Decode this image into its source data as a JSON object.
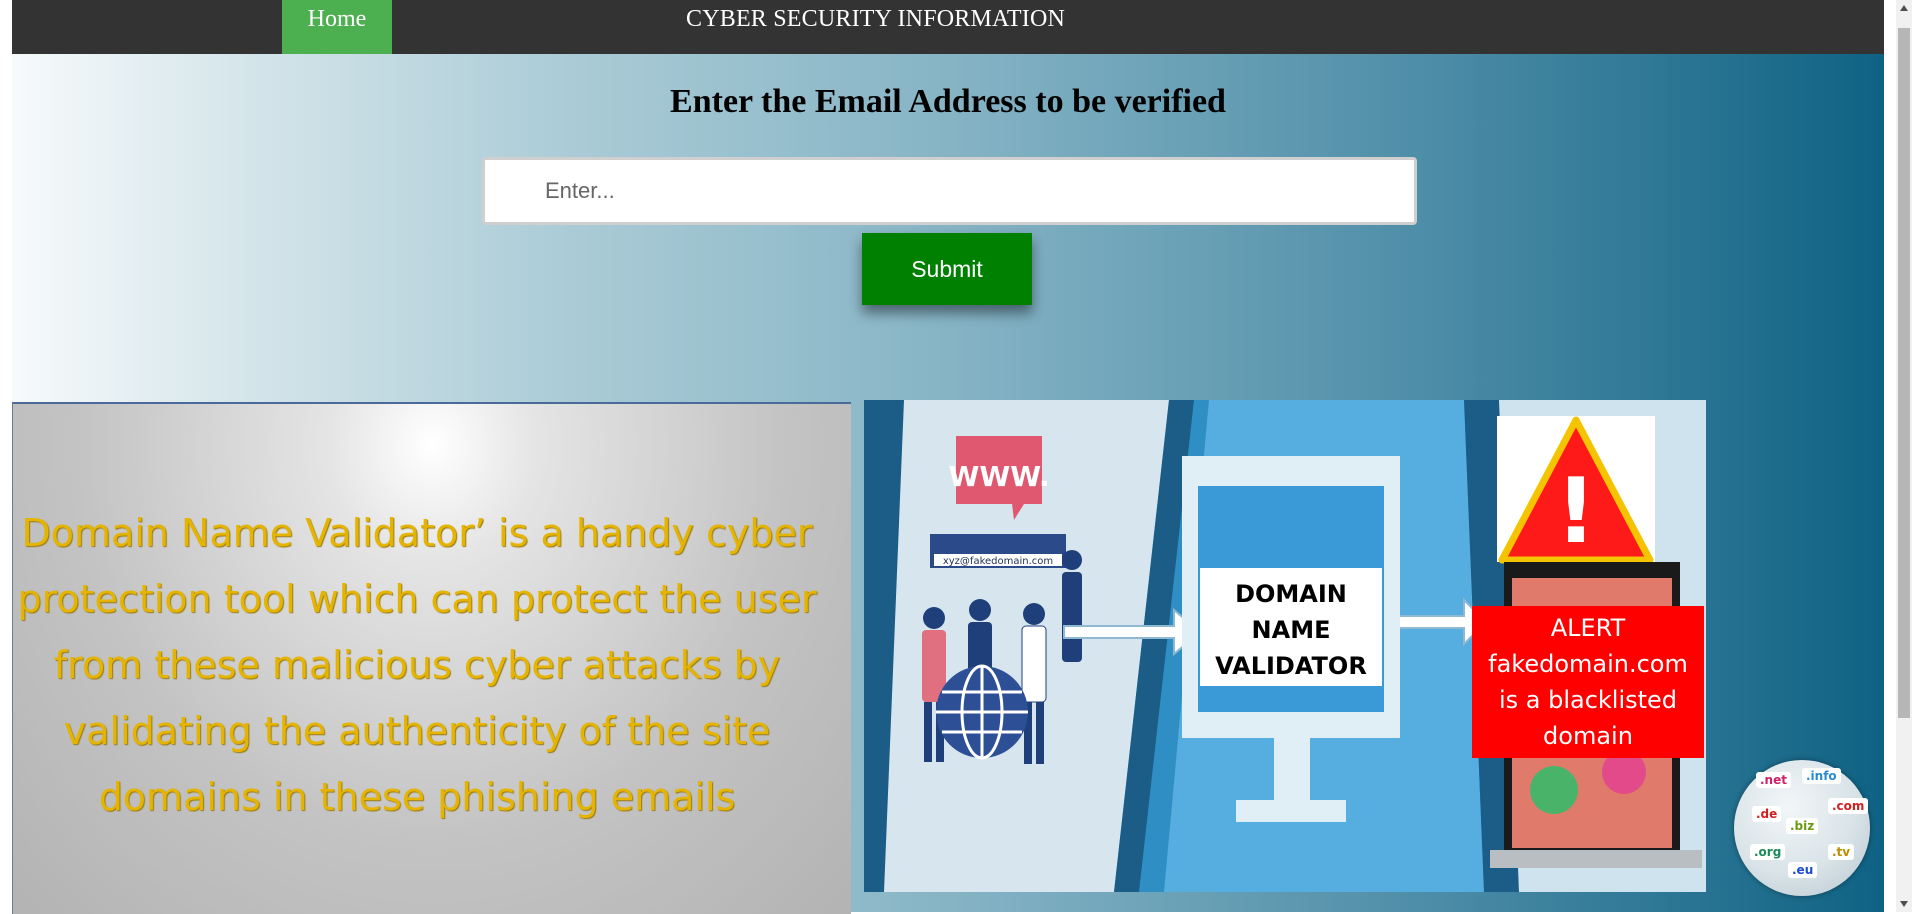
{
  "nav": {
    "home_label": "Home",
    "site_title": "CYBER SECURITY INFORMATION"
  },
  "form": {
    "heading": "Enter the Email Address to be verified",
    "email_placeholder": "Enter...",
    "submit_label": "Submit"
  },
  "info_banner": {
    "text": "Domain Name Validator’ is a handy cyber protection tool which can protect the user from these malicious cyber attacks by validating the authenticity of the site domains in these phishing emails"
  },
  "validator_graphic": {
    "www_label": "WWW.",
    "email_example": "xyz@fakedomain.com",
    "validator_line1": "DOMAIN",
    "validator_line2": "NAME",
    "validator_line3": "VALIDATOR",
    "alert_title": "ALERT",
    "alert_domain": "fakedomain.com",
    "alert_line2": "is a blacklisted",
    "alert_line3": "domain",
    "warning_mark": "!"
  },
  "tld_badge": {
    "tlds": [
      ".net",
      ".info",
      ".com",
      ".de",
      ".biz",
      ".org",
      ".tv",
      ".eu"
    ]
  },
  "colors": {
    "nav_bg": "#333333",
    "home_bg": "#4caf50",
    "submit_bg": "#008000",
    "banner_text": "#e5b400",
    "alert_red": "#ff0000"
  }
}
